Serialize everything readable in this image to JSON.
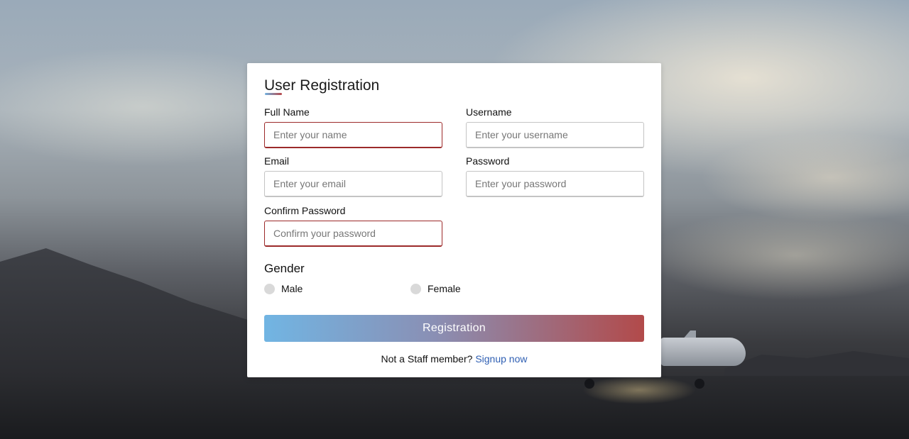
{
  "form": {
    "title": "User Registration",
    "fields": {
      "full_name": {
        "label": "Full Name",
        "placeholder": "Enter your name",
        "value": ""
      },
      "username": {
        "label": "Username",
        "placeholder": "Enter your username",
        "value": ""
      },
      "email": {
        "label": "Email",
        "placeholder": "Enter your email",
        "value": ""
      },
      "password": {
        "label": "Password",
        "placeholder": "Enter your password",
        "value": ""
      },
      "confirm_password": {
        "label": "Confirm Password",
        "placeholder": "Confirm your password",
        "value": ""
      }
    },
    "gender": {
      "title": "Gender",
      "options": [
        {
          "label": "Male",
          "selected": false
        },
        {
          "label": "Female",
          "selected": false
        }
      ]
    },
    "submit_label": "Registration",
    "footer": {
      "text": "Not a Staff member?",
      "link_label": "Signup now"
    }
  },
  "colors": {
    "invalid_border": "#9c2a2a",
    "button_gradient_start": "#71b5e3",
    "button_gradient_end": "#b24a4a",
    "link": "#2f5fb3"
  }
}
